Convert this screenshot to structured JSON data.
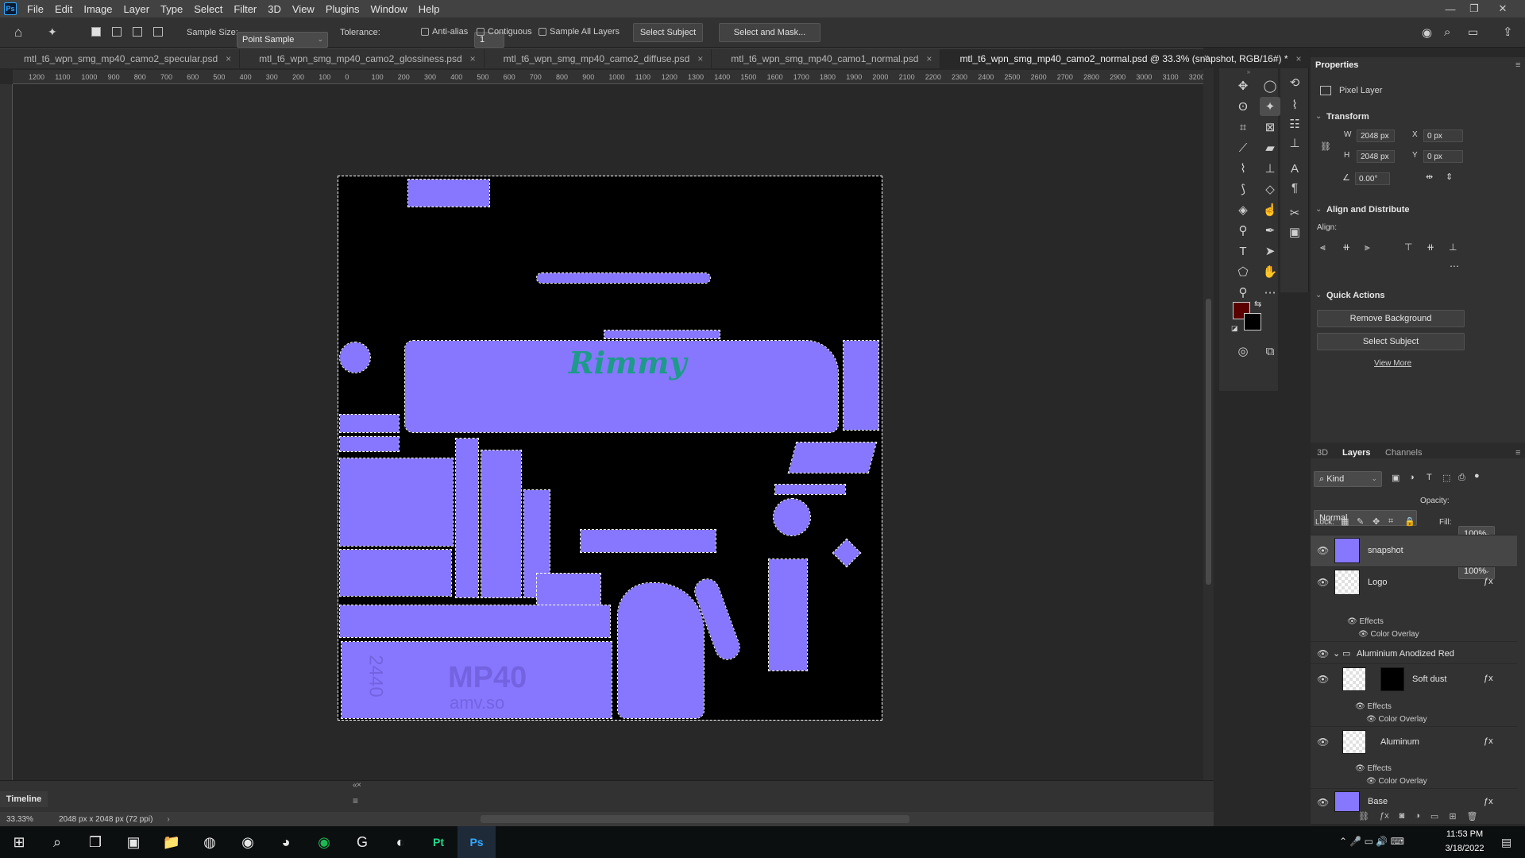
{
  "app": {
    "logo_text": "Ps",
    "window_controls": [
      "—",
      "❐",
      "✕"
    ]
  },
  "menu": [
    "File",
    "Edit",
    "Image",
    "Layer",
    "Type",
    "Select",
    "Filter",
    "3D",
    "View",
    "Plugins",
    "Window",
    "Help"
  ],
  "options": {
    "sample_size_label": "Sample Size:",
    "sample_size_value": "Point Sample",
    "tolerance_label": "Tolerance:",
    "tolerance_value": "1",
    "anti_alias": "Anti-alias",
    "contiguous": "Contiguous",
    "sample_all_layers": "Sample All Layers",
    "select_subject": "Select Subject",
    "select_and_mask": "Select and Mask..."
  },
  "tabs": [
    {
      "label": "mtl_t6_wpn_smg_mp40_camo2_specular.psd",
      "active": false
    },
    {
      "label": "mtl_t6_wpn_smg_mp40_camo2_glossiness.psd",
      "active": false
    },
    {
      "label": "mtl_t6_wpn_smg_mp40_camo2_diffuse.psd",
      "active": false
    },
    {
      "label": "mtl_t6_wpn_smg_mp40_camo1_normal.psd",
      "active": false
    },
    {
      "label": "mtl_t6_wpn_smg_mp40_camo2_normal.psd @ 33.3% (snapshot, RGB/16#) *",
      "active": true
    }
  ],
  "ruler_top": [
    "1200",
    "1100",
    "1000",
    "900",
    "800",
    "700",
    "600",
    "500",
    "400",
    "300",
    "200",
    "100",
    "0",
    "100",
    "200",
    "300",
    "400",
    "500",
    "600",
    "700",
    "800",
    "900",
    "1000",
    "1100",
    "1200",
    "1300",
    "1400",
    "1500",
    "1600",
    "1700",
    "1800",
    "1900",
    "2000",
    "2100",
    "2200",
    "2300",
    "2400",
    "2500",
    "2600",
    "2700",
    "2800",
    "2900",
    "3000",
    "3100",
    "3200"
  ],
  "canvas": {
    "logo_text": "Rimmy",
    "emboss_text": "MP40",
    "emboss_sub": "amv.so",
    "emboss_side": "2440",
    "accent": "#8777ff",
    "logo_color": "#1e9a8a"
  },
  "timeline": {
    "label": "Timeline"
  },
  "status": {
    "zoom": "33.33%",
    "doc_info": "2048 px x 2048 px (72 ppi)"
  },
  "properties": {
    "title": "Properties",
    "type": "Pixel Layer",
    "transform_title": "Transform",
    "w_label": "W",
    "w_value": "2048 px",
    "h_label": "H",
    "h_value": "2048 px",
    "x_label": "X",
    "x_value": "0 px",
    "y_label": "Y",
    "y_value": "0 px",
    "angle": "0.00°",
    "align_title": "Align and Distribute",
    "align_label": "Align:",
    "quick_actions_title": "Quick Actions",
    "remove_bg": "Remove Background",
    "select_subject": "Select Subject",
    "view_more": "View More"
  },
  "layers_panel": {
    "tabs": [
      "3D",
      "Layers",
      "Channels"
    ],
    "active_tab": "Layers",
    "filter": "Kind",
    "blend_mode": "Normal",
    "opacity_label": "Opacity:",
    "opacity": "100%",
    "lock_label": "Lock:",
    "fill_label": "Fill:",
    "fill": "100%",
    "layers": [
      {
        "name": "snapshot"
      },
      {
        "name": "Logo",
        "effects": "Effects",
        "effect": "Color Overlay"
      },
      {
        "name": "Aluminium Anodized Red"
      },
      {
        "name": "Soft dust",
        "effects": "Effects",
        "effect": "Color Overlay"
      },
      {
        "name": "Aluminum",
        "effects": "Effects",
        "effect": "Color Overlay"
      },
      {
        "name": "Base"
      }
    ]
  },
  "colors": {
    "foreground": "#5a0000",
    "background": "#000000"
  },
  "taskbar": {
    "time": "11:53 PM",
    "date": "3/18/2022"
  }
}
